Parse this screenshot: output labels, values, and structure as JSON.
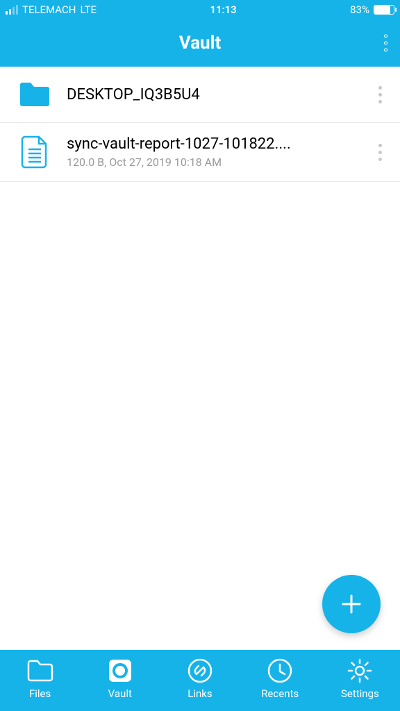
{
  "status": {
    "carrier": "TELEMACH",
    "network": "LTE",
    "time": "11:13",
    "battery_pct": "83%"
  },
  "header": {
    "title": "Vault"
  },
  "items": [
    {
      "type": "folder",
      "name": "DESKTOP_IQ3B5U4",
      "meta": ""
    },
    {
      "type": "file",
      "name": "sync-vault-report-1027-101822....",
      "meta": "120.0 B, Oct 27, 2019 10:18 AM"
    }
  ],
  "tabs": {
    "files": "Files",
    "vault": "Vault",
    "links": "Links",
    "recents": "Recents",
    "settings": "Settings"
  },
  "colors": {
    "accent": "#16b3e9"
  }
}
